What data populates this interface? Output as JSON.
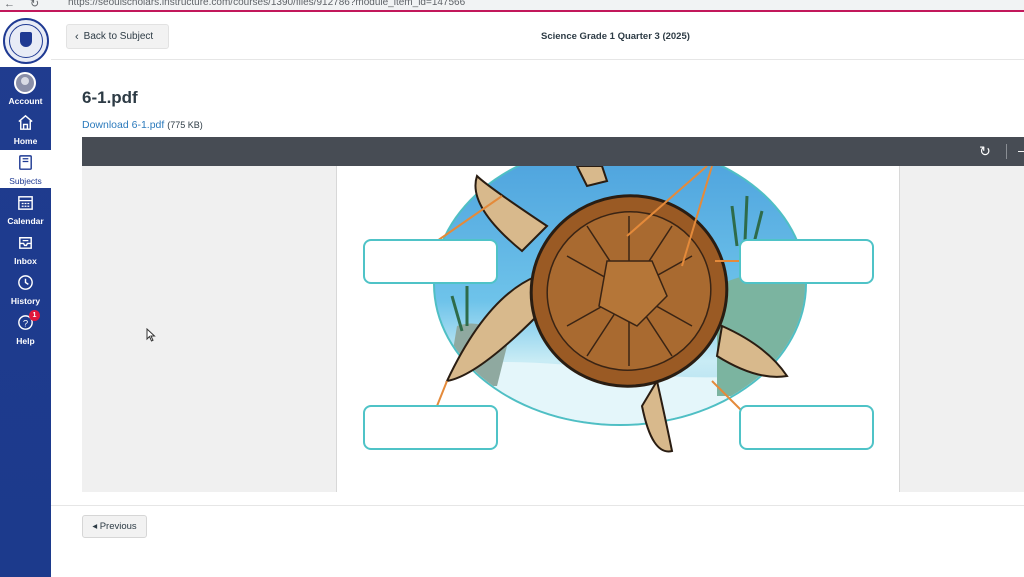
{
  "browser": {
    "url": "https://seoulscholars.instructure.com/courses/1390/files/912786?module_item_id=147566"
  },
  "nav": {
    "items": [
      {
        "label": "Account",
        "icon": "avatar"
      },
      {
        "label": "Home",
        "icon": "home-icon"
      },
      {
        "label": "Subjects",
        "icon": "book-icon",
        "active": true
      },
      {
        "label": "Calendar",
        "icon": "calendar-icon"
      },
      {
        "label": "Inbox",
        "icon": "inbox-icon"
      },
      {
        "label": "History",
        "icon": "clock-icon"
      },
      {
        "label": "Help",
        "icon": "help-icon",
        "badge": "1"
      }
    ]
  },
  "header": {
    "back_label": "Back to Subject",
    "course_title": "Science Grade 1 Quarter 3 (2025)"
  },
  "file": {
    "title": "6-1.pdf",
    "download_label": "Download 6-1.pdf",
    "size": "(775 KB)"
  },
  "footer": {
    "previous_label": "◂ Previous"
  },
  "colors": {
    "nav_bg": "#1f3a93",
    "link": "#2b7abc",
    "toolbar": "#474c54",
    "label_box": "#4fc3c7",
    "shell": "#a0652a"
  }
}
